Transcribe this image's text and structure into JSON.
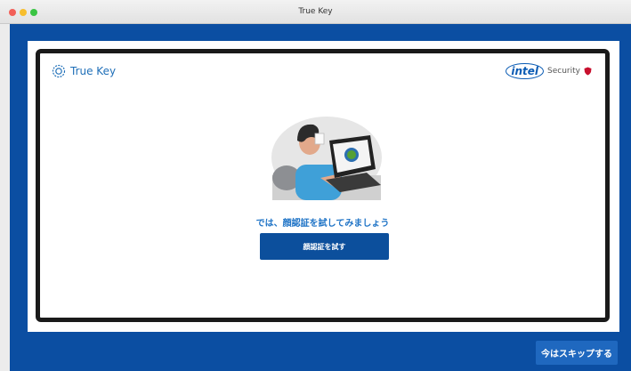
{
  "window": {
    "title": "True Key"
  },
  "brand": {
    "logo_text": "True Key",
    "partner_logo": "intel",
    "partner_text": "Security"
  },
  "setup": {
    "message": "では、顔認証を試してみましょう",
    "primary_button": "顔認証を試す",
    "skip_button": "今はスキップする"
  },
  "icons": {
    "logo": "true-key-logo-icon",
    "illustration": "face-recognition-illustration",
    "partner_badge": "shield-icon"
  },
  "colors": {
    "background": "#0b4ea2",
    "primary_button": "#0c4f9c",
    "accent_text": "#1e73c6"
  }
}
